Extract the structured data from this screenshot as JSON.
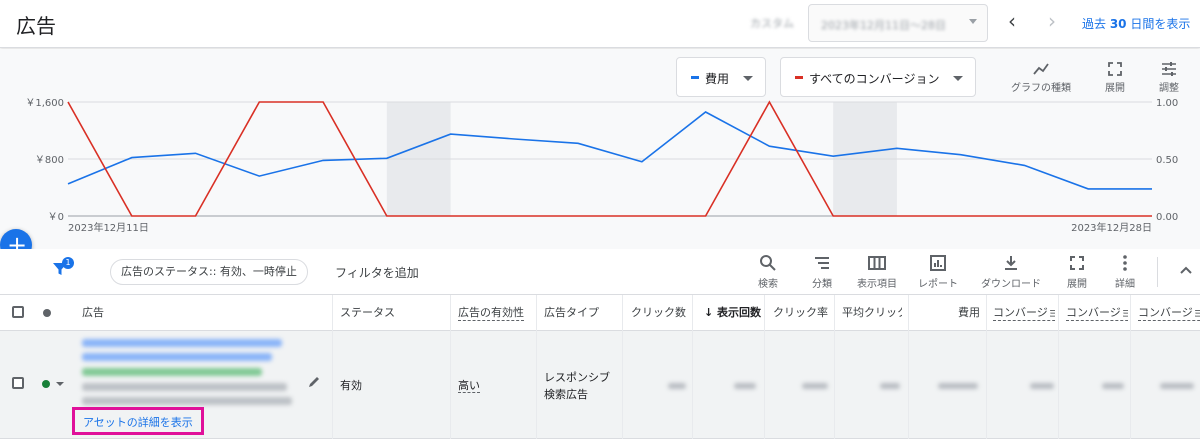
{
  "page_title": "広告",
  "date_range": {
    "label": "カスタム",
    "value": "2023年12月11日～28日"
  },
  "period_link": {
    "prefix": "過去 ",
    "days": "30",
    "suffix": " 日間を表示"
  },
  "chart_controls": {
    "metric1": {
      "label": "費用",
      "color": "#1a73e8"
    },
    "metric2": {
      "label": "すべてのコンバージョン",
      "color": "#d93025"
    },
    "tools": [
      {
        "label": "グラフの種類",
        "icon": "line-chart-icon"
      },
      {
        "label": "展開",
        "icon": "expand-icon"
      },
      {
        "label": "調整",
        "icon": "tune-icon"
      }
    ]
  },
  "chart_data": {
    "type": "line",
    "x": [
      "2023-12-11",
      "2023-12-12",
      "2023-12-13",
      "2023-12-14",
      "2023-12-15",
      "2023-12-16",
      "2023-12-17",
      "2023-12-18",
      "2023-12-19",
      "2023-12-20",
      "2023-12-21",
      "2023-12-22",
      "2023-12-23",
      "2023-12-24",
      "2023-12-25",
      "2023-12-26",
      "2023-12-27",
      "2023-12-28"
    ],
    "series": [
      {
        "name": "費用",
        "axis": "left",
        "color": "#1a73e8",
        "values": [
          450,
          820,
          880,
          560,
          780,
          810,
          1150,
          1080,
          1020,
          760,
          1460,
          980,
          840,
          950,
          860,
          710,
          380,
          380
        ]
      },
      {
        "name": "すべてのコンバージョン",
        "axis": "right",
        "color": "#d93025",
        "values": [
          1.0,
          0.0,
          0.0,
          1.0,
          1.0,
          0.0,
          0.0,
          0.0,
          0.0,
          0.0,
          0.0,
          1.0,
          0.0,
          0.0,
          0.0,
          0.0,
          0.0,
          0.0
        ]
      }
    ],
    "y_left": {
      "ticks": [
        "￥1,600",
        "￥800",
        "￥0"
      ],
      "range": [
        0,
        1600
      ]
    },
    "y_right": {
      "ticks": [
        "1.00",
        "0.50",
        "0.00"
      ],
      "range": [
        0,
        1
      ]
    },
    "x_labels": {
      "start": "2023年12月11日",
      "end": "2023年12月28日"
    },
    "weekend_shading": [
      [
        "2023-12-16",
        "2023-12-17"
      ],
      [
        "2023-12-23",
        "2023-12-24"
      ]
    ],
    "grid": true
  },
  "toolbar": {
    "filter_badge": "1",
    "chip": "広告のステータス:: 有効、一時停止",
    "add_filter": "フィルタを追加",
    "tools": [
      {
        "label": "検索",
        "icon": "search-icon"
      },
      {
        "label": "分類",
        "icon": "segment-icon"
      },
      {
        "label": "表示項目",
        "icon": "columns-icon"
      },
      {
        "label": "レポート",
        "icon": "report-icon"
      },
      {
        "label": "ダウンロード",
        "icon": "download-icon"
      },
      {
        "label": "展開",
        "icon": "expand-icon"
      },
      {
        "label": "詳細",
        "icon": "more-vert-icon"
      }
    ]
  },
  "table": {
    "headers": {
      "ad": "広告",
      "status": "ステータス",
      "strength": "広告の有効性",
      "type": "広告タイプ",
      "clicks": "クリック数",
      "impressions": "表示回数",
      "ctr": "クリック率",
      "avg_cpc": "平均クリック単価",
      "cost": "費用",
      "conv1": "コンバージョン",
      "conv2": "コンバージョン",
      "conv3": "コンバージョン"
    },
    "row": {
      "status": "有効",
      "strength": "高い",
      "type": "レスポンシブ検索広告",
      "asset_link": "アセットの詳細を表示"
    }
  }
}
